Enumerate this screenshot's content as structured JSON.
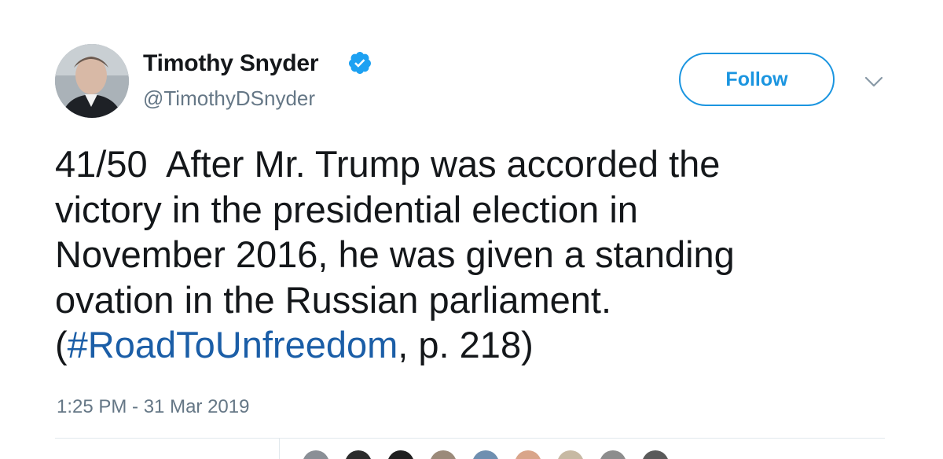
{
  "author": {
    "name": "Timothy Snyder",
    "handle": "@TimothyDSnyder",
    "verified": true,
    "avatar_icon": "user-avatar"
  },
  "header": {
    "follow_label": "Follow",
    "more_icon": "chevron-down-icon"
  },
  "tweet": {
    "lines": [
      "41/50  After Mr. Trump was accorded the",
      "victory in the presidential election in",
      "November 2016, he was given a standing",
      "ovation in the Russian parliament."
    ],
    "last_line_prefix": "(",
    "hashtag": "#RoadToUnfreedom",
    "last_line_suffix": ", p. 218)"
  },
  "timestamp": "1:25 PM - 31 Mar 2019",
  "colors": {
    "accent": "#1b95e0",
    "hashtag": "#1b5ea7",
    "text": "#14171a",
    "secondary": "#657786",
    "divider": "#e1e8ed"
  },
  "liker_colors": [
    "#8a8f96",
    "#2b2b2b",
    "#1f1f1f",
    "#9b8a7a",
    "#6f8fb0",
    "#d9a58a",
    "#c7b9a3",
    "#8d8d8d",
    "#5a5a5a"
  ]
}
